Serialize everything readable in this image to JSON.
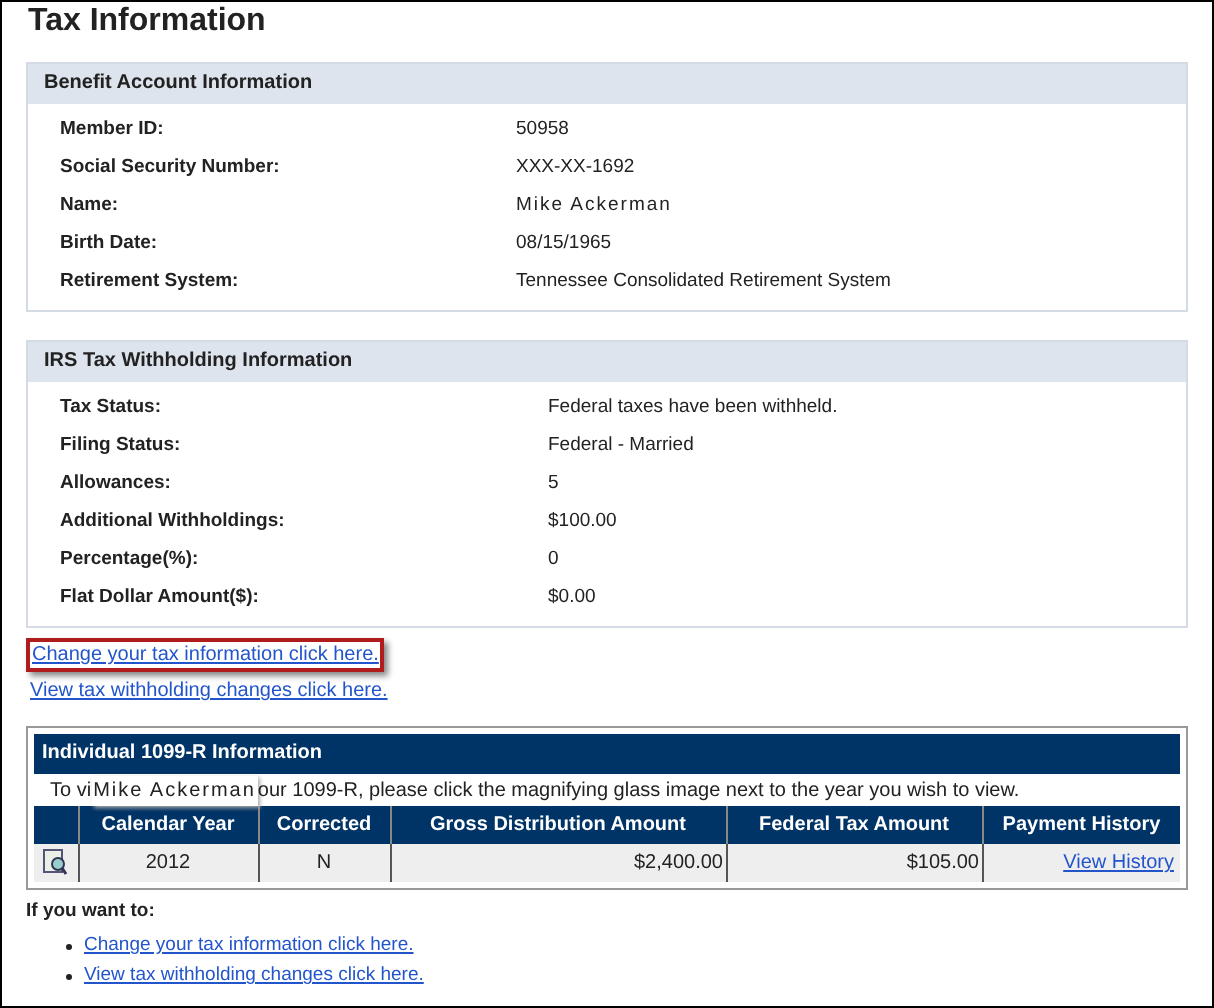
{
  "title": "Tax Information",
  "sections": [
    {
      "heading": "Benefit Account Information",
      "rows": [
        {
          "label": "Member ID:",
          "value": "50958"
        },
        {
          "label": "Social Security Number:",
          "value": "XXX-XX-1692"
        },
        {
          "label": "Name:",
          "value": "Mike Ackerman",
          "kind": "spaced"
        },
        {
          "label": "Birth Date:",
          "value": "08/15/1965"
        },
        {
          "label": "Retirement System:",
          "value": "Tennessee Consolidated Retirement System"
        }
      ]
    },
    {
      "heading": "IRS Tax Withholding Information",
      "rows": [
        {
          "label": "Tax Status:",
          "value": "Federal taxes have been withheld."
        },
        {
          "label": "Filing Status:",
          "value": "Federal - Married"
        },
        {
          "label": "Allowances:",
          "value": "5"
        },
        {
          "label": "Additional Withholdings:",
          "value": "$100.00"
        },
        {
          "label": "Percentage(%):",
          "value": "0"
        },
        {
          "label": "Flat Dollar Amount($):",
          "value": "$0.00"
        }
      ]
    }
  ],
  "links": [
    {
      "text": "Change your tax information click here.",
      "highlighted": true
    },
    {
      "text": "View tax withholding changes click here.",
      "highlighted": false
    }
  ],
  "form_1099r": {
    "heading": "Individual 1099-R Information",
    "instruction_start": "To vi",
    "name_overlay": "Mike Ackerman",
    "instruction_end": "our 1099-R, please click the magnifying glass image next to the year you wish to view.",
    "columns": [
      "Calendar Year",
      "Corrected",
      "Gross Distribution Amount",
      "Federal Tax Amount",
      "Payment History"
    ],
    "rows": [
      {
        "calendar_year": "2012",
        "corrected": "N",
        "gross": "$2,400.00",
        "federal_tax": "$105.00",
        "payment_history": "View History"
      }
    ]
  },
  "if_you_want": {
    "heading": "If you want to:",
    "links": [
      "Change your tax information click here.",
      "View tax withholding changes click here."
    ]
  }
}
